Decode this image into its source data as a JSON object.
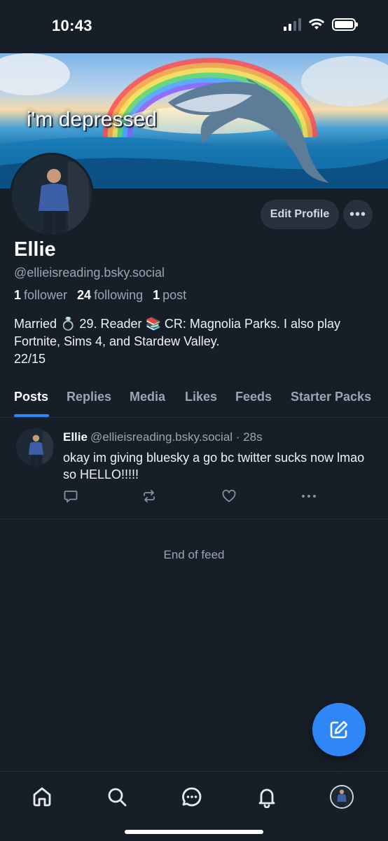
{
  "status_bar": {
    "time": "10:43"
  },
  "banner": {
    "text": "i'm depressed"
  },
  "profile": {
    "display_name": "Ellie",
    "handle": "@ellieisreading.bsky.social",
    "followers_count": "1",
    "followers_label": "follower",
    "following_count": "24",
    "following_label": "following",
    "posts_count": "1",
    "posts_label": "post",
    "bio": "Married 💍 29. Reader 📚 CR: Magnolia Parks. I also play\nFortnite, Sims 4, and Stardew Valley.\n22/15",
    "edit_label": "Edit Profile",
    "more_label": "•••"
  },
  "tabs": [
    {
      "label": "Posts",
      "active": true
    },
    {
      "label": "Replies",
      "active": false
    },
    {
      "label": "Media",
      "active": false
    },
    {
      "label": "Likes",
      "active": false
    },
    {
      "label": "Feeds",
      "active": false
    },
    {
      "label": "Starter Packs",
      "active": false
    }
  ],
  "posts": [
    {
      "author": "Ellie",
      "handle": "@ellieisreading.bsky.social",
      "time": "· 28s",
      "text": "okay im giving bluesky a go bc twitter sucks now lmao so HELLO!!!!!"
    }
  ],
  "feed": {
    "end_label": "End of feed"
  },
  "icons": {
    "reply": "reply-icon",
    "repost": "repost-icon",
    "like": "heart-icon",
    "more": "more-icon",
    "compose": "compose-icon",
    "home": "home-icon",
    "search": "search-icon",
    "chat": "chat-icon",
    "notifications": "bell-icon"
  },
  "colors": {
    "accent": "#2f86f6",
    "background": "#161e27",
    "muted": "#9aa6b3"
  }
}
